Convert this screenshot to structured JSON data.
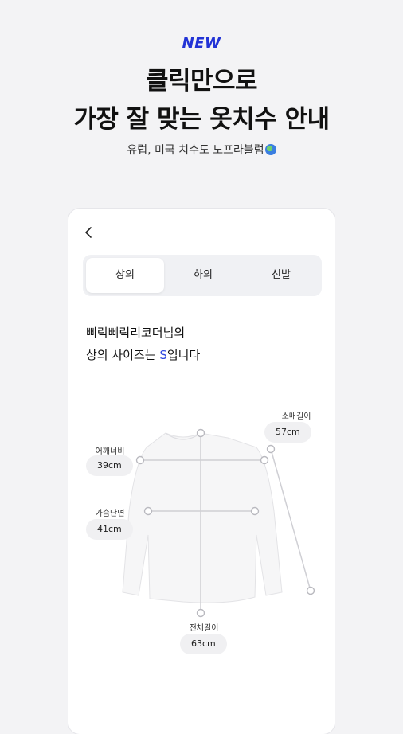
{
  "hero": {
    "badge": "NEW",
    "title_line1": "클릭만으로",
    "title_line2": "가장 잘 맞는 옷치수 안내",
    "subtitle": "유럽, 미국 치수도 노프라블럼"
  },
  "tabs": [
    {
      "label": "상의",
      "active": true
    },
    {
      "label": "하의",
      "active": false
    },
    {
      "label": "신발",
      "active": false
    }
  ],
  "message": {
    "line1": "삐릭삐릭리코더님의",
    "line2_prefix": "상의 사이즈는 ",
    "size": "S",
    "line2_suffix": "입니다"
  },
  "measurements": {
    "sleeve": {
      "label": "소매길이",
      "value": "57cm"
    },
    "shoulder": {
      "label": "어깨너비",
      "value": "39cm"
    },
    "chest": {
      "label": "가슴단면",
      "value": "41cm"
    },
    "length": {
      "label": "전체길이",
      "value": "63cm"
    }
  },
  "colors": {
    "accent": "#2f48e0",
    "badge": "#2233d6",
    "background": "#f3f3f5"
  }
}
